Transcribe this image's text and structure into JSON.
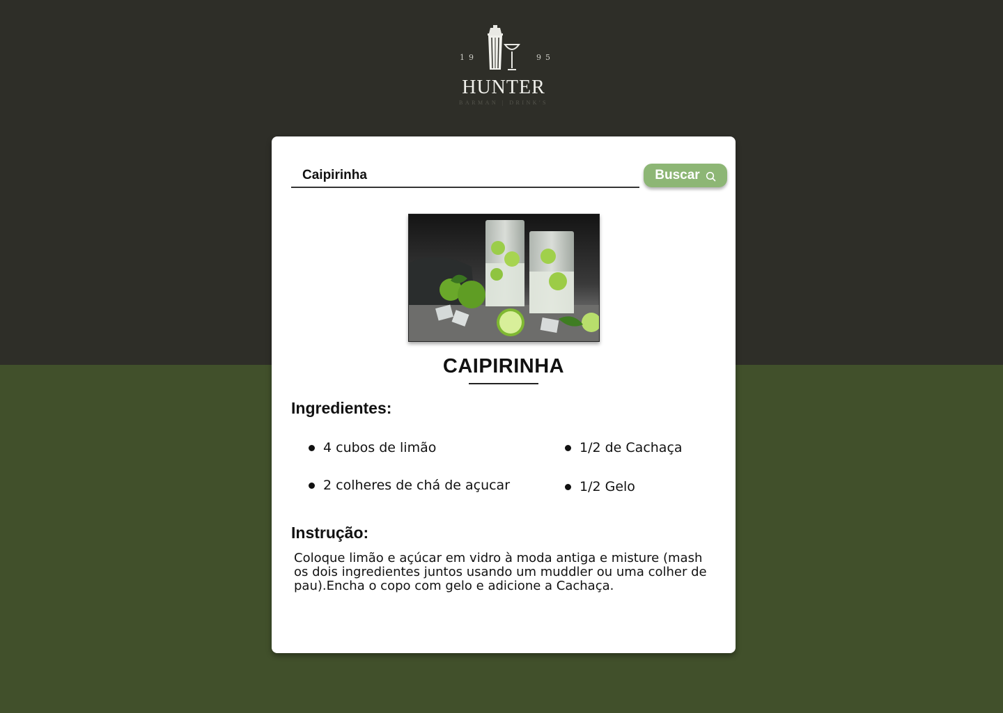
{
  "logo": {
    "year_left": "19",
    "year_right": "95",
    "brand": "HUNTER",
    "tagline": "BARMAN | DRINK'S"
  },
  "search": {
    "value": "Caipirinha",
    "button_label": "Buscar"
  },
  "drink": {
    "name": "CAIPIRINHA",
    "ingredients_heading": "Ingredientes:",
    "ingredients": [
      "4 cubos de limão",
      "1/2 de Cachaça",
      "2 colheres de chá de açucar",
      "1/2 Gelo"
    ],
    "instruction_heading": "Instrução:",
    "instruction": "Coloque limão e açúcar em vidro à moda antiga e misture (mash os dois ingredientes juntos usando um muddler ou uma colher de pau).Encha o copo com gelo e adicione a Cachaça."
  },
  "colors": {
    "background_top": "#2e2e28",
    "background_bottom": "#41502b",
    "card": "#ffffff",
    "button_accent": "#8db675"
  }
}
